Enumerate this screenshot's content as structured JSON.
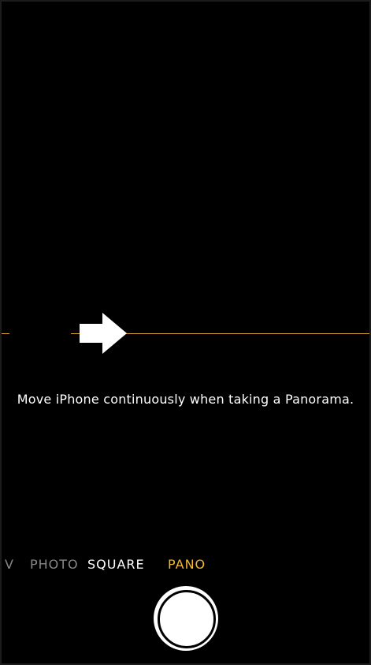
{
  "instruction": {
    "text": "Move iPhone continuously when taking a Panorama."
  },
  "modes": [
    {
      "label": "VIDEO",
      "state": "offscreen"
    },
    {
      "label": "PHOTO",
      "state": "inactive"
    },
    {
      "label": "SQUARE",
      "state": "inactive"
    },
    {
      "label": "PANO",
      "state": "selected"
    }
  ],
  "icons": {
    "direction_arrow": "arrow-right-icon",
    "shutter": "shutter-button"
  },
  "colors": {
    "background": "#000000",
    "accent": "#f5b82e",
    "guide_line": "#d8a030",
    "text": "#ffffff"
  }
}
